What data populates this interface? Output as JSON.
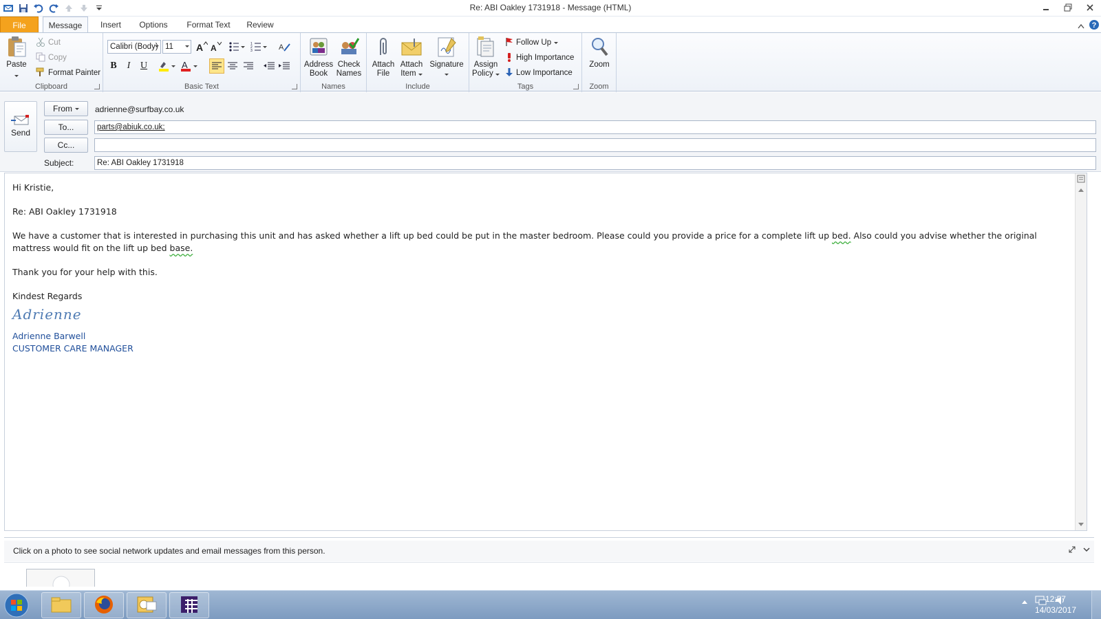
{
  "window": {
    "title": "Re: ABI Oakley 1731918 - Message (HTML)"
  },
  "tabs": [
    "File",
    "Message",
    "Insert",
    "Options",
    "Format Text",
    "Review"
  ],
  "ribbon": {
    "clipboard": {
      "label": "Clipboard",
      "paste": "Paste",
      "cut": "Cut",
      "copy": "Copy",
      "format_painter": "Format Painter"
    },
    "basic_text": {
      "label": "Basic Text",
      "font_name": "Calibri (Body)",
      "font_size": "11"
    },
    "names": {
      "label": "Names",
      "address_book_1": "Address",
      "address_book_2": "Book",
      "check_names_1": "Check",
      "check_names_2": "Names"
    },
    "include": {
      "label": "Include",
      "attach_file_1": "Attach",
      "attach_file_2": "File",
      "attach_item_1": "Attach",
      "attach_item_2": "Item",
      "signature": "Signature"
    },
    "tags": {
      "label": "Tags",
      "assign_policy_1": "Assign",
      "assign_policy_2": "Policy",
      "follow_up": "Follow Up",
      "high_importance": "High Importance",
      "low_importance": "Low Importance"
    },
    "zoom": {
      "label": "Zoom",
      "zoom": "Zoom"
    }
  },
  "header": {
    "send": "Send",
    "from_button": "From",
    "from_value": "adrienne@surfbay.co.uk",
    "to_button": "To...",
    "to_value": "parts@abiuk.co.uk;",
    "cc_button": "Cc...",
    "cc_value": "",
    "subject_label": "Subject:",
    "subject_value": "Re: ABI Oakley 1731918"
  },
  "body": {
    "greeting": "Hi Kristie,",
    "reference": "Re: ABI Oakley 1731918",
    "para1_a": "We have a customer that is interested in purchasing this unit and has asked whether a lift up bed could be put in the master bedroom.  Please could you provide a price for a complete lift up ",
    "para1_b": "bed.",
    "para1_c": "  Also could you advise whether the original mattress would fit on the lift up bed ",
    "para1_d": "base.",
    "thanks": "Thank you for your help with this.",
    "closing": "Kindest Regards",
    "signature_script": "Adrienne",
    "signature_name": "Adrienne Barwell",
    "signature_title": "CUSTOMER CARE MANAGER"
  },
  "people_pane": {
    "message": "Click on a photo to see social network updates and email messages from this person."
  },
  "taskbar": {
    "time": "12:57",
    "date": "14/03/2017"
  },
  "colors": {
    "file_tab": "#f4a21d",
    "signature_blue": "#1f4e9a",
    "taskbar": "#8aa7ca"
  }
}
